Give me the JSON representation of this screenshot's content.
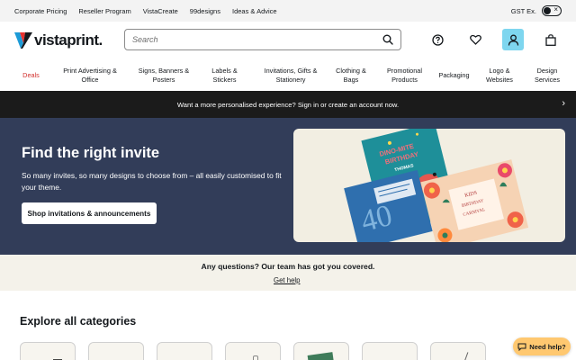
{
  "utility_bar": {
    "links": [
      "Corporate Pricing",
      "Reseller Program",
      "VistaCreate",
      "99designs",
      "Ideas & Advice"
    ],
    "tax_toggle_label": "GST Ex."
  },
  "header": {
    "logo_text": "vistaprint.",
    "search_placeholder": "Search",
    "icons": [
      "help-icon",
      "heart-icon",
      "account-icon",
      "bag-icon"
    ]
  },
  "nav": {
    "items": [
      {
        "label": "Deals",
        "lines": [
          "Deals"
        ]
      },
      {
        "label": "Print Advertising & Office",
        "lines": [
          "Print Advertising &",
          "Office"
        ]
      },
      {
        "label": "Signs, Banners & Posters",
        "lines": [
          "Signs, Banners &",
          "Posters"
        ]
      },
      {
        "label": "Labels & Stickers",
        "lines": [
          "Labels &",
          "Stickers"
        ]
      },
      {
        "label": "Invitations, Gifts & Stationery",
        "lines": [
          "Invitations, Gifts &",
          "Stationery"
        ]
      },
      {
        "label": "Clothing & Bags",
        "lines": [
          "Clothing &",
          "Bags"
        ]
      },
      {
        "label": "Promotional Products",
        "lines": [
          "Promotional",
          "Products"
        ]
      },
      {
        "label": "Packaging",
        "lines": [
          "Packaging"
        ]
      },
      {
        "label": "Logo & Websites",
        "lines": [
          "Logo &",
          "Websites"
        ]
      },
      {
        "label": "Design Services",
        "lines": [
          "Design",
          "Services"
        ]
      }
    ]
  },
  "promo": {
    "text": "Want a more personalised experience? Sign in or create an account now."
  },
  "hero": {
    "title": "Find the right invite",
    "description": "So many invites, so many designs to choose from – all easily customised to fit your theme.",
    "cta_label": "Shop invitations & announcements",
    "card_text": {
      "dino_line1": "DINO-MITE",
      "dino_line2": "BIRTHDAY",
      "dino_name": "THOMAS",
      "kids_name": "KIDS",
      "kids_sub": "BIRTHDAY",
      "kids_event": "CARNIVAL",
      "big_numeral": "40"
    }
  },
  "help": {
    "question": "Any questions? Our team has got you covered.",
    "link_label": "Get help"
  },
  "explore": {
    "title": "Explore all categories",
    "category_count_visible": 8
  },
  "chat": {
    "label": "Need help?"
  },
  "colors": {
    "hero_bg": "#323d59",
    "promo_bg": "#1b1b1b",
    "deals_red": "#d2302d",
    "account_blue": "#7ed6ef",
    "chat_orange": "#ffc870",
    "help_band_bg": "#f4f2ea"
  }
}
